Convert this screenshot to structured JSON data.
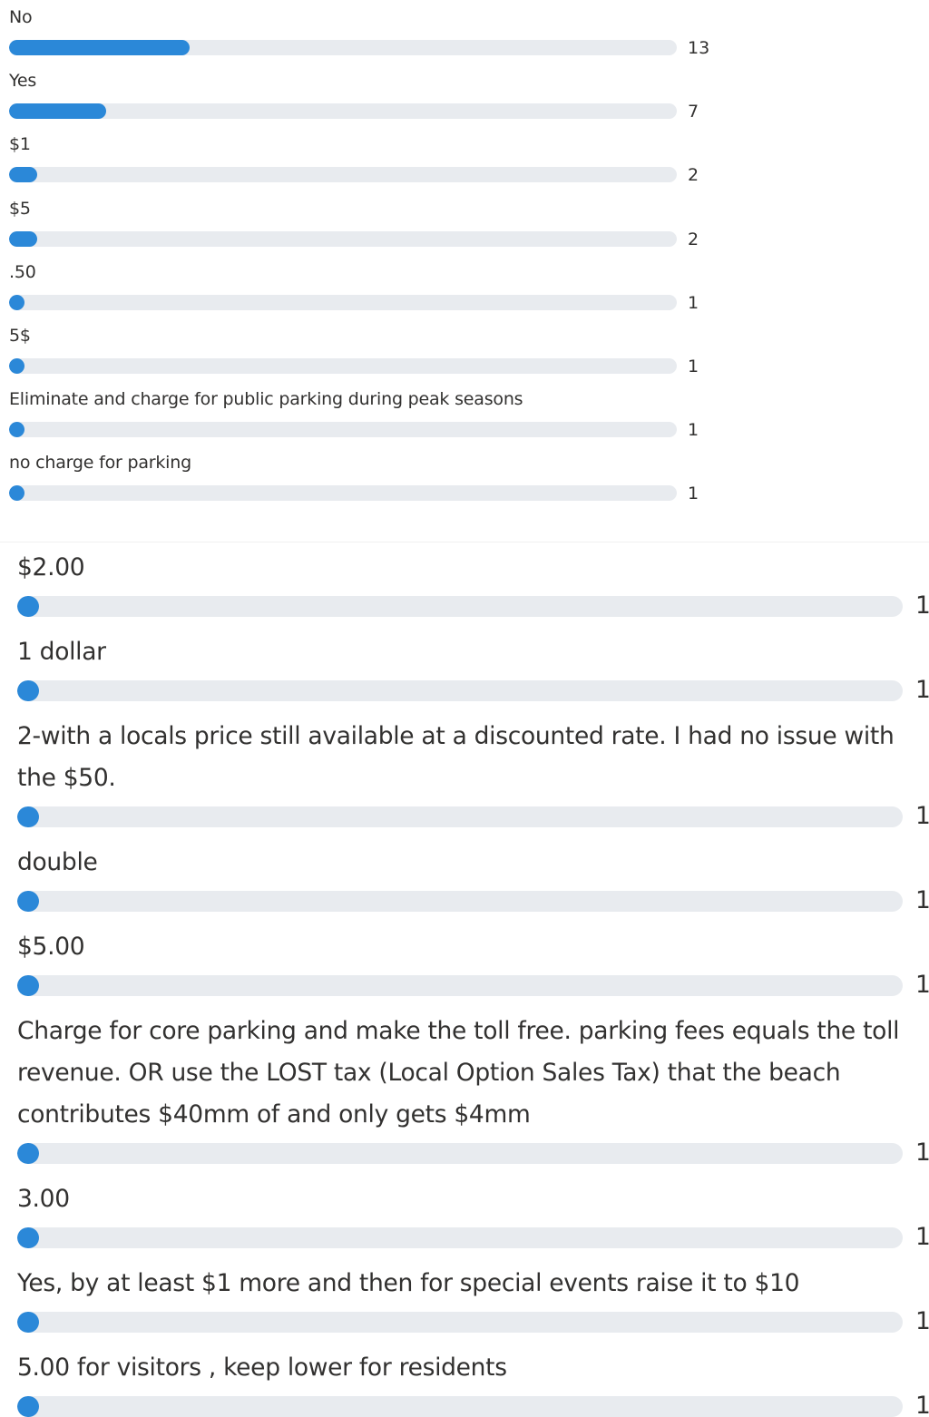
{
  "poll_results_top": {
    "max_count": 48,
    "items": [
      {
        "label": "No",
        "count": "13",
        "value": 13
      },
      {
        "label": "Yes",
        "count": "7",
        "value": 7
      },
      {
        "label": "$1",
        "count": "2",
        "value": 2
      },
      {
        "label": "$5",
        "count": "2",
        "value": 2
      },
      {
        "label": ".50",
        "count": "1",
        "value": 1
      },
      {
        "label": "5$",
        "count": "1",
        "value": 1
      },
      {
        "label": "Eliminate and charge for public parking during peak seasons",
        "count": "1",
        "value": 1
      },
      {
        "label": "no charge for parking",
        "count": "1",
        "value": 1
      }
    ]
  },
  "poll_results_bottom": {
    "max_count": 40,
    "items": [
      {
        "label": "$2.00",
        "count": "1",
        "value": 1
      },
      {
        "label": "1 dollar",
        "count": "1",
        "value": 1
      },
      {
        "label": "2-with a locals price still available at a discounted rate. I had no issue with the $50.",
        "count": "1",
        "value": 1
      },
      {
        "label": "double",
        "count": "1",
        "value": 1
      },
      {
        "label": "$5.00",
        "count": "1",
        "value": 1
      },
      {
        "label": "Charge for core parking and make the toll free. parking fees equals the toll revenue. OR use the LOST tax (Local Option Sales Tax) that the beach contributes $40mm of and only gets $4mm",
        "count": "1",
        "value": 1
      },
      {
        "label": "3.00",
        "count": "1",
        "value": 1
      },
      {
        "label": "Yes, by at least $1 more and then for special events raise it to $10",
        "count": "1",
        "value": 1
      },
      {
        "label": "5.00 for visitors , keep lower for residents",
        "count": "1",
        "value": 1
      }
    ]
  },
  "colors": {
    "bar_fill": "#2b88d8",
    "bar_track": "#e8ebef",
    "text": "#323130"
  }
}
